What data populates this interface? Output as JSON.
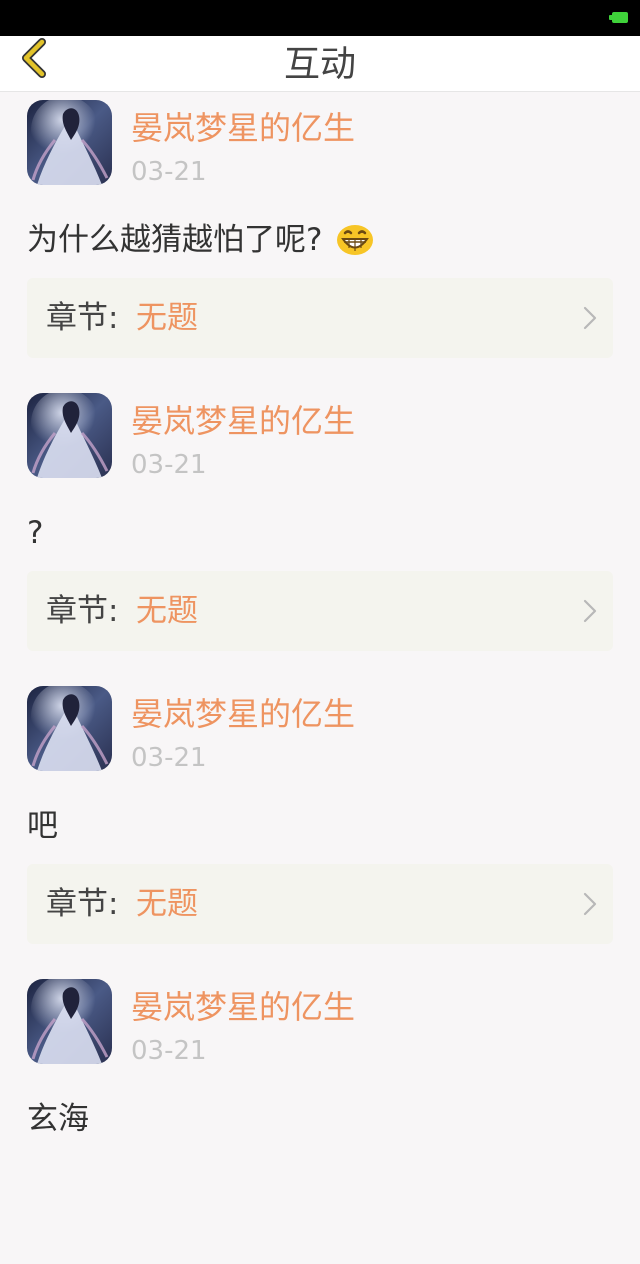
{
  "header": {
    "title": "互动"
  },
  "feed": {
    "items": [
      {
        "username": "晏岚梦星的亿生",
        "date": "03-21",
        "content": "为什么越猜越怕了呢?",
        "has_emoji": true,
        "chapter_label": "章节:",
        "chapter_title": "无题"
      },
      {
        "username": "晏岚梦星的亿生",
        "date": "03-21",
        "content": "?",
        "has_emoji": false,
        "chapter_label": "章节:",
        "chapter_title": "无题"
      },
      {
        "username": "晏岚梦星的亿生",
        "date": "03-21",
        "content": "吧",
        "has_emoji": false,
        "chapter_label": "章节:",
        "chapter_title": "无题"
      },
      {
        "username": "晏岚梦星的亿生",
        "date": "03-21",
        "content": "玄海",
        "has_emoji": false
      }
    ]
  },
  "icons": {
    "back": "chevron-left-icon",
    "emoji": "grinning-face-icon",
    "chapter_arrow": "chevron-right-icon"
  },
  "colors": {
    "accent": "#ee9461",
    "back_icon": "#e2c32a",
    "battery": "#3fd23a"
  }
}
